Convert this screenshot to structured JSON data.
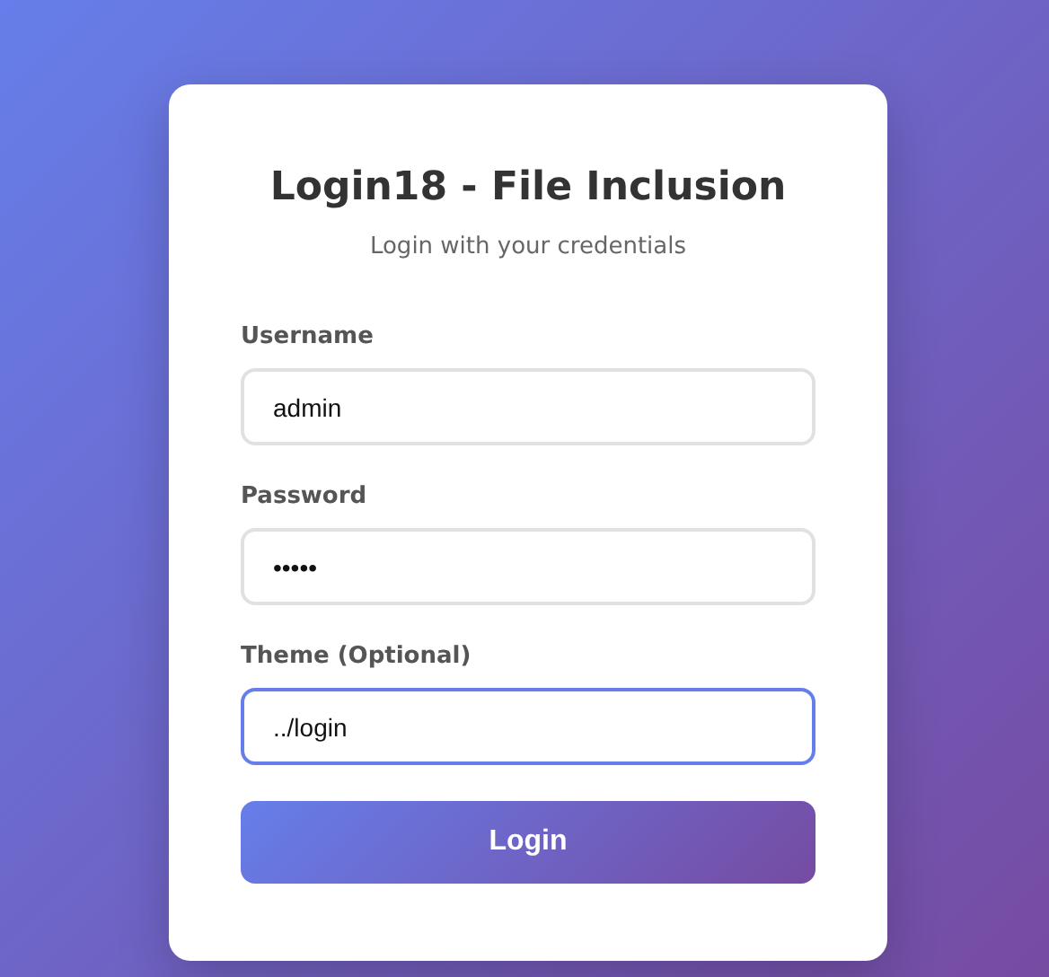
{
  "card": {
    "title": "Login18 - File Inclusion",
    "subtitle": "Login with your credentials"
  },
  "fields": [
    {
      "label": "Username",
      "value": "admin",
      "focused": false
    },
    {
      "label": "Password",
      "value": "•••••",
      "focused": false
    },
    {
      "label": "Theme (Optional)",
      "value": "../login",
      "focused": true
    }
  ],
  "button": {
    "label": "Login"
  }
}
